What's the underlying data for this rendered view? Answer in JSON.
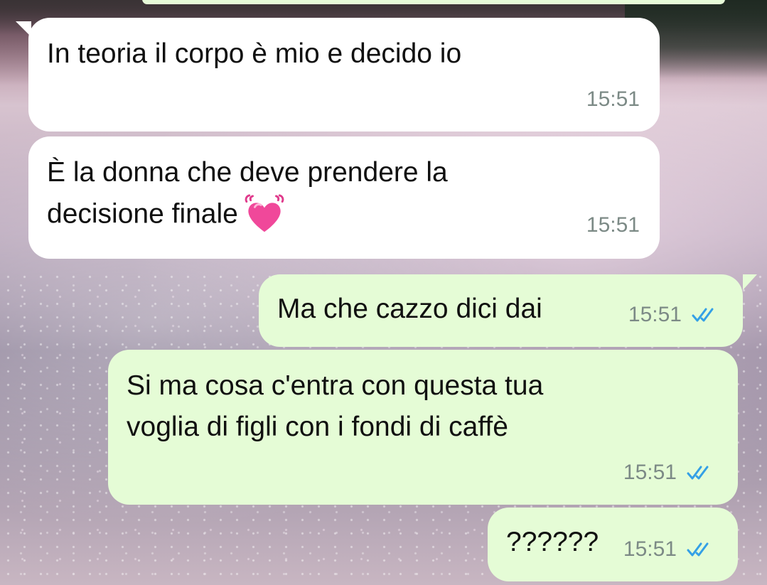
{
  "messages": [
    {
      "direction": "incoming",
      "text": "In teoria il corpo è mio e decido io",
      "time": "15:51"
    },
    {
      "direction": "incoming",
      "text": "È la donna che deve prendere la\ndecisione finale",
      "emoji": "beating-heart-icon",
      "time": "15:51"
    },
    {
      "direction": "outgoing",
      "text": "Ma che cazzo dici dai",
      "time": "15:51",
      "status": "read"
    },
    {
      "direction": "outgoing",
      "text": "Si ma cosa c'entra con questa tua\nvoglia di figli con i fondi di caffè",
      "time": "15:51",
      "status": "read"
    },
    {
      "direction": "outgoing",
      "text": "??????",
      "time": "15:51",
      "status": "read"
    }
  ],
  "colors": {
    "incoming_bubble": "#ffffff",
    "outgoing_bubble": "#e5fcd6",
    "timestamp": "#7c8a86",
    "read_ticks": "#34a0e6",
    "heart": "#f0489a"
  }
}
